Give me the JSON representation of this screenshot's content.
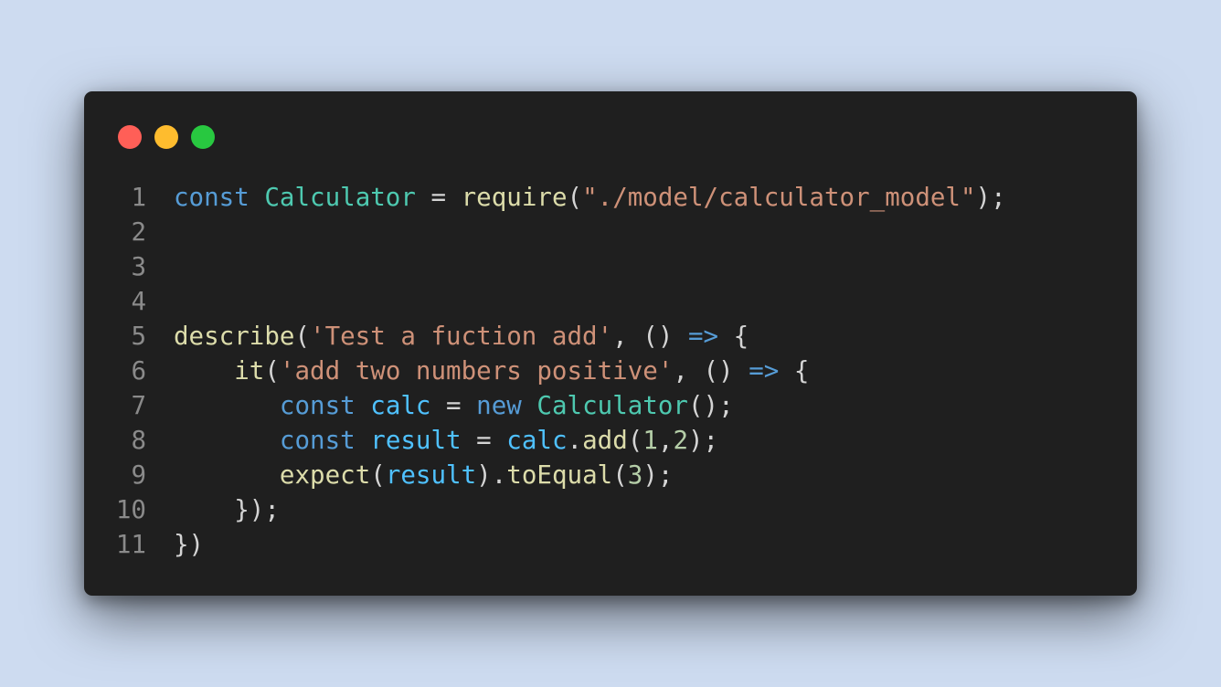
{
  "window": {
    "controls": [
      {
        "name": "close",
        "color": "#ff5f57"
      },
      {
        "name": "minimize",
        "color": "#febc2e"
      },
      {
        "name": "maximize",
        "color": "#28c840"
      }
    ]
  },
  "editor": {
    "language": "javascript",
    "theme_colors": {
      "background": "#1f1f1f",
      "keyword": "#569cd6",
      "class": "#4ec9b0",
      "function": "#dcdcaa",
      "string": "#ce9178",
      "variable": "#4fc1ff",
      "number": "#b5cea8",
      "punctuation": "#d4d4d4",
      "line_number": "#8a8a8a"
    },
    "lines": [
      {
        "number": "1",
        "tokens": [
          {
            "t": "kw",
            "v": "const"
          },
          {
            "t": "pn",
            "v": " "
          },
          {
            "t": "cls",
            "v": "Calculator"
          },
          {
            "t": "pn",
            "v": " = "
          },
          {
            "t": "fn",
            "v": "require"
          },
          {
            "t": "pn",
            "v": "("
          },
          {
            "t": "str",
            "v": "\"./model/calculator_model\""
          },
          {
            "t": "pn",
            "v": ");"
          }
        ]
      },
      {
        "number": "2",
        "tokens": []
      },
      {
        "number": "3",
        "tokens": []
      },
      {
        "number": "4",
        "tokens": []
      },
      {
        "number": "5",
        "tokens": [
          {
            "t": "fn",
            "v": "describe"
          },
          {
            "t": "pn",
            "v": "("
          },
          {
            "t": "str",
            "v": "'Test a fuction add'"
          },
          {
            "t": "pn",
            "v": ", () "
          },
          {
            "t": "kw",
            "v": "=>"
          },
          {
            "t": "pn",
            "v": " {"
          }
        ]
      },
      {
        "number": "6",
        "tokens": [
          {
            "t": "pn",
            "v": "    "
          },
          {
            "t": "fn",
            "v": "it"
          },
          {
            "t": "pn",
            "v": "("
          },
          {
            "t": "str",
            "v": "'add two numbers positive'"
          },
          {
            "t": "pn",
            "v": ", () "
          },
          {
            "t": "kw",
            "v": "=>"
          },
          {
            "t": "pn",
            "v": " {"
          }
        ]
      },
      {
        "number": "7",
        "tokens": [
          {
            "t": "pn",
            "v": "       "
          },
          {
            "t": "kw",
            "v": "const"
          },
          {
            "t": "pn",
            "v": " "
          },
          {
            "t": "var",
            "v": "calc"
          },
          {
            "t": "pn",
            "v": " = "
          },
          {
            "t": "kw",
            "v": "new"
          },
          {
            "t": "pn",
            "v": " "
          },
          {
            "t": "cls",
            "v": "Calculator"
          },
          {
            "t": "pn",
            "v": "();"
          }
        ]
      },
      {
        "number": "8",
        "tokens": [
          {
            "t": "pn",
            "v": "       "
          },
          {
            "t": "kw",
            "v": "const"
          },
          {
            "t": "pn",
            "v": " "
          },
          {
            "t": "var",
            "v": "result"
          },
          {
            "t": "pn",
            "v": " = "
          },
          {
            "t": "var",
            "v": "calc"
          },
          {
            "t": "pn",
            "v": "."
          },
          {
            "t": "fn",
            "v": "add"
          },
          {
            "t": "pn",
            "v": "("
          },
          {
            "t": "num",
            "v": "1"
          },
          {
            "t": "pn",
            "v": ","
          },
          {
            "t": "num",
            "v": "2"
          },
          {
            "t": "pn",
            "v": ");"
          }
        ]
      },
      {
        "number": "9",
        "tokens": [
          {
            "t": "pn",
            "v": "       "
          },
          {
            "t": "fn",
            "v": "expect"
          },
          {
            "t": "pn",
            "v": "("
          },
          {
            "t": "var",
            "v": "result"
          },
          {
            "t": "pn",
            "v": ")."
          },
          {
            "t": "fn",
            "v": "toEqual"
          },
          {
            "t": "pn",
            "v": "("
          },
          {
            "t": "num",
            "v": "3"
          },
          {
            "t": "pn",
            "v": ");"
          }
        ]
      },
      {
        "number": "10",
        "tokens": [
          {
            "t": "pn",
            "v": "    });"
          }
        ]
      },
      {
        "number": "11",
        "tokens": [
          {
            "t": "pn",
            "v": "})"
          }
        ]
      }
    ]
  }
}
